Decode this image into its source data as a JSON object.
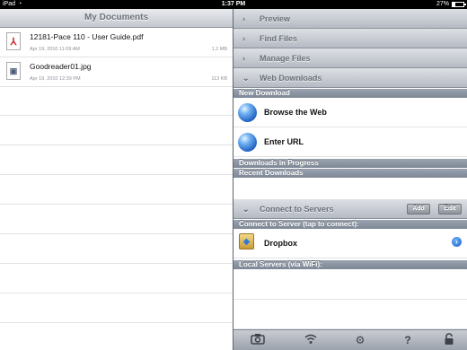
{
  "status_bar": {
    "device": "iPad",
    "time": "1:37 PM",
    "battery": "27%",
    "battery_fraction": 0.27
  },
  "left_pane": {
    "title": "My Documents",
    "files": [
      {
        "name": "12181-Pace 110 - User Guide.pdf",
        "date": "Apr 19, 2010 11:09 AM",
        "size": "1.2 MB",
        "type": "pdf"
      },
      {
        "name": "Goodreader01.jpg",
        "date": "Apr 19, 2010 12:39 PM",
        "size": "113 KB",
        "type": "jpg"
      }
    ]
  },
  "right_pane": {
    "sections": {
      "preview": "Preview",
      "find_files": "Find Files",
      "manage_files": "Manage Files",
      "web_downloads": "Web Downloads",
      "connect_to_servers": "Connect to Servers"
    },
    "subheaders": {
      "new_download": "New Download",
      "downloads_in_progress": "Downloads in Progress",
      "recent_downloads": "Recent Downloads",
      "connect_to_server": "Connect to Server (tap to connect):",
      "local_servers": "Local Servers (via WiFi):"
    },
    "actions": {
      "browse_web": "Browse the Web",
      "enter_url": "Enter URL",
      "dropbox": "Dropbox"
    },
    "buttons": {
      "add": "Add",
      "edit": "Edit"
    }
  },
  "toolbar": {
    "icons": [
      "camera-icon",
      "wifi-icon",
      "gear-icon",
      "help-icon",
      "lock-icon"
    ]
  }
}
